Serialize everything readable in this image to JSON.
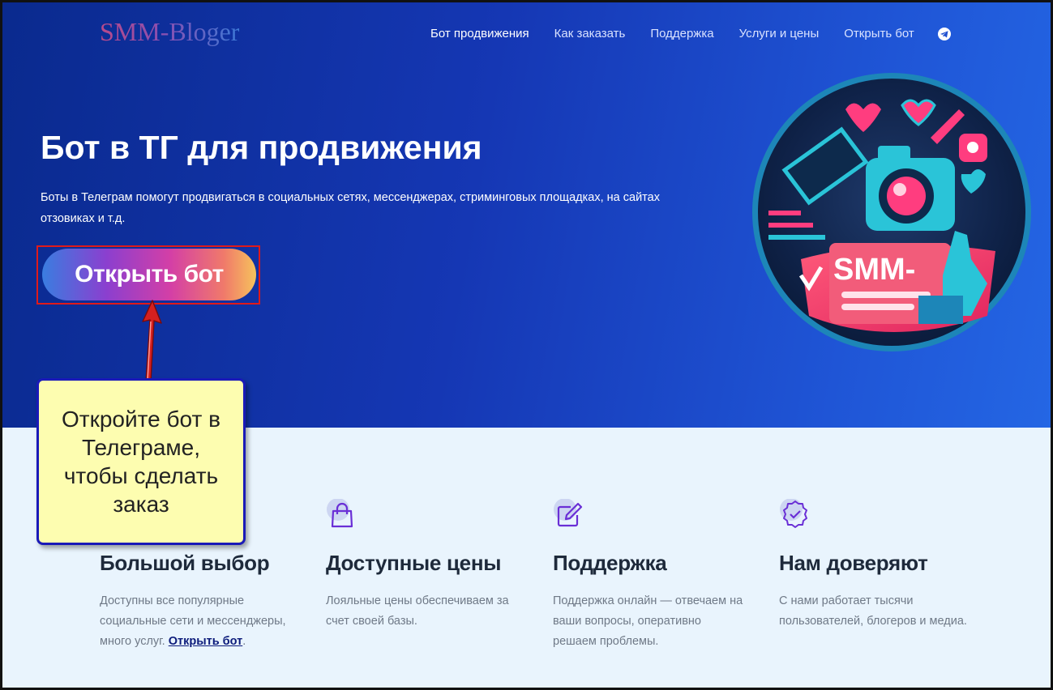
{
  "header": {
    "logo": "SMM-Bloger",
    "nav": [
      {
        "label": "Бот продвижения",
        "active": true
      },
      {
        "label": "Как заказать",
        "active": false
      },
      {
        "label": "Поддержка",
        "active": false
      },
      {
        "label": "Услуги и цены",
        "active": false
      },
      {
        "label": "Открыть бот",
        "active": false
      }
    ],
    "social_icon": "telegram-icon"
  },
  "hero": {
    "title": "Бот в ТГ для продвижения",
    "subtitle": "Боты в Телеграм помогут продвигаться в социальных сетях, мессенджерах, стриминговых площадках, на сайтах отзовиках и т.д.",
    "cta_label": "Открыть бот",
    "illustration_text": "SMM-"
  },
  "annotation": {
    "text": "Откройте бот в Телеграме, чтобы сделать заказ",
    "highlight_color": "#e01a1a",
    "arrow_color": "#d42020"
  },
  "features": [
    {
      "icon": "shopping-bag-icon",
      "title": "Большой выбор",
      "text": "Доступны все популярные социальные сети и мессенджеры, много услуг.",
      "link": "Открыть бот",
      "link_suffix": "."
    },
    {
      "icon": "shopping-bag-icon",
      "title": "Доступные цены",
      "text": "Лояльные цены обеспечиваем за счет своей базы."
    },
    {
      "icon": "edit-icon",
      "title": "Поддержка",
      "text": "Поддержка онлайн — отвечаем на ваши вопросы, оперативно решаем проблемы."
    },
    {
      "icon": "verified-badge-icon",
      "title": "Нам доверяют",
      "text": "С нами работает тысячи пользователей, блогеров и медиа."
    }
  ],
  "colors": {
    "hero_bg": "#1537b4",
    "lower_bg": "#e9f4fd",
    "icon_accent": "#6a2fd6",
    "note_bg": "#fdfdb0",
    "note_border": "#1a1ab8"
  }
}
